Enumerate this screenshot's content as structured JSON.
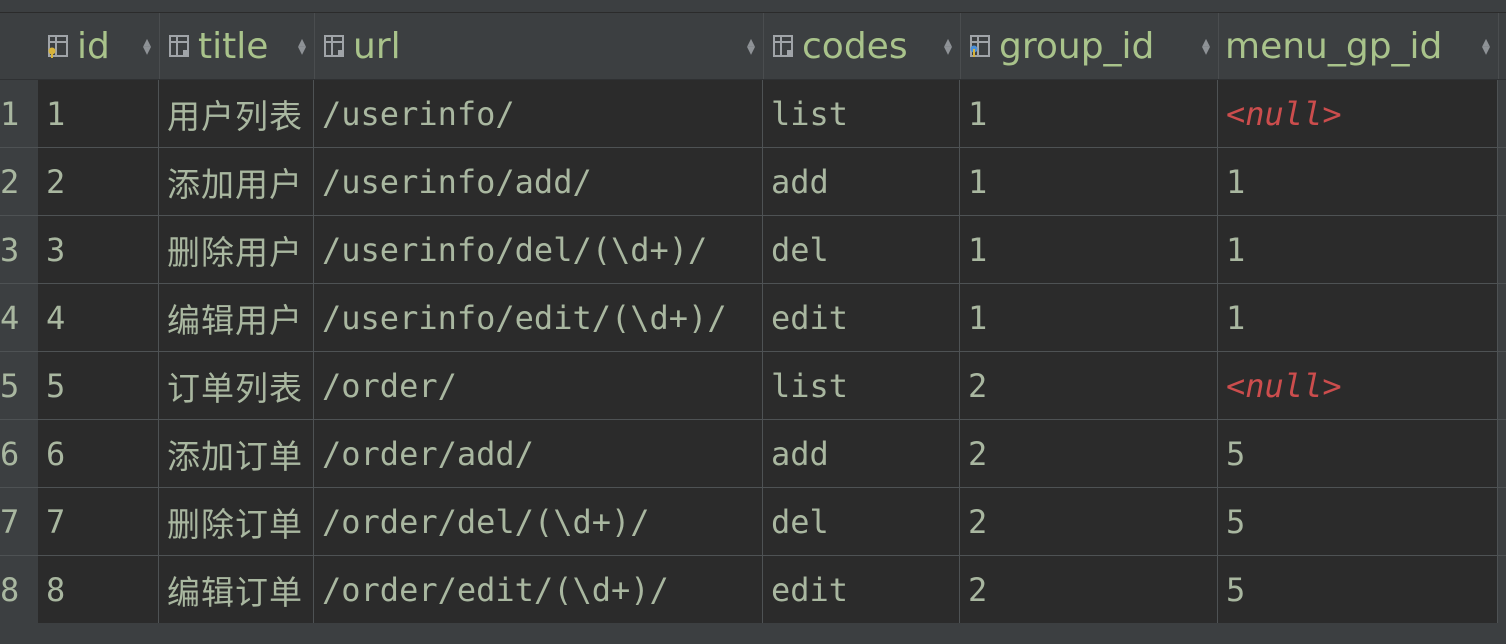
{
  "columns": [
    {
      "key": "id",
      "label": "id",
      "icon": "primary-key-column-icon"
    },
    {
      "key": "title",
      "label": "title",
      "icon": "column-icon"
    },
    {
      "key": "url",
      "label": "url",
      "icon": "column-icon"
    },
    {
      "key": "codes",
      "label": "codes",
      "icon": "column-icon"
    },
    {
      "key": "group_id",
      "label": "group_id",
      "icon": "foreign-key-column-icon"
    },
    {
      "key": "menu_gp_id",
      "label": "menu_gp_id",
      "icon": "none"
    }
  ],
  "rows": [
    {
      "num": "1",
      "id": "1",
      "title": "用户列表",
      "url": "/userinfo/",
      "codes": "list",
      "group_id": "1",
      "menu_gp_id": "<null>"
    },
    {
      "num": "2",
      "id": "2",
      "title": "添加用户",
      "url": "/userinfo/add/",
      "codes": "add",
      "group_id": "1",
      "menu_gp_id": "1"
    },
    {
      "num": "3",
      "id": "3",
      "title": "删除用户",
      "url": "/userinfo/del/(\\d+)/",
      "codes": "del",
      "group_id": "1",
      "menu_gp_id": "1"
    },
    {
      "num": "4",
      "id": "4",
      "title": "编辑用户",
      "url": "/userinfo/edit/(\\d+)/",
      "codes": "edit",
      "group_id": "1",
      "menu_gp_id": "1"
    },
    {
      "num": "5",
      "id": "5",
      "title": "订单列表",
      "url": "/order/",
      "codes": "list",
      "group_id": "2",
      "menu_gp_id": "<null>"
    },
    {
      "num": "6",
      "id": "6",
      "title": "添加订单",
      "url": "/order/add/",
      "codes": "add",
      "group_id": "2",
      "menu_gp_id": "5"
    },
    {
      "num": "7",
      "id": "7",
      "title": "删除订单",
      "url": "/order/del/(\\d+)/",
      "codes": "del",
      "group_id": "2",
      "menu_gp_id": "5"
    },
    {
      "num": "8",
      "id": "8",
      "title": "编辑订单",
      "url": "/order/edit/(\\d+)/",
      "codes": "edit",
      "group_id": "2",
      "menu_gp_id": "5"
    }
  ],
  "colors": {
    "header_text": "#a9c38b",
    "cell_text": "#a9b7a0",
    "null_text": "#cc4d4d",
    "cell_bg": "#2b2b2b",
    "header_bg": "#3c3f41"
  }
}
